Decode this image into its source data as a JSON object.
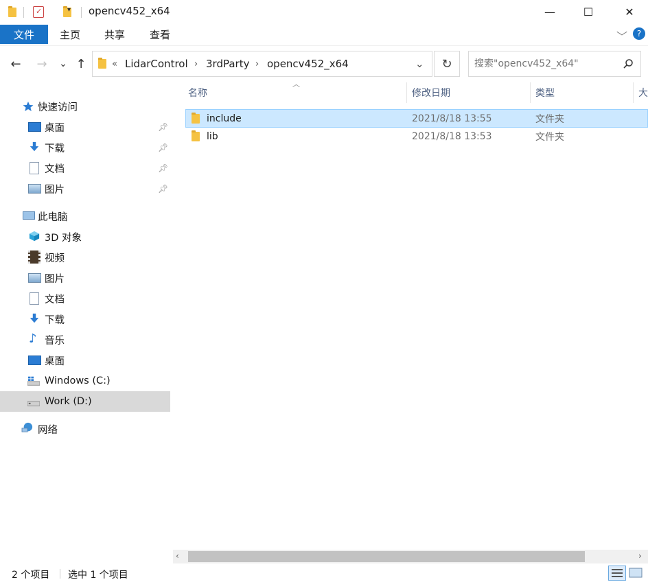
{
  "window": {
    "title": "opencv452_x64",
    "minimize_glyph": "—",
    "maximize_glyph": "☐",
    "close_glyph": "✕"
  },
  "ribbon": {
    "tabs": [
      "文件",
      "主页",
      "共享",
      "查看"
    ],
    "expand_glyph": "﹀",
    "help_glyph": "?"
  },
  "nav": {
    "back_glyph": "←",
    "forward_glyph": "→",
    "recent_glyph": "⌄",
    "up_glyph": "↑",
    "refresh_glyph": "↻",
    "overflow_glyph": "«",
    "dropdown_glyph": "⌄"
  },
  "breadcrumb": [
    "LidarControl",
    "3rdParty",
    "opencv452_x64"
  ],
  "search": {
    "placeholder": "搜索\"opencv452_x64\"",
    "icon": "search-icon"
  },
  "sidebar": {
    "quick_access": "快速访问",
    "quick_items": [
      {
        "label": "桌面",
        "icon": "desktop-icon",
        "pinned": true
      },
      {
        "label": "下载",
        "icon": "download-icon",
        "pinned": true
      },
      {
        "label": "文档",
        "icon": "document-icon",
        "pinned": true
      },
      {
        "label": "图片",
        "icon": "pictures-icon",
        "pinned": true
      }
    ],
    "this_pc": "此电脑",
    "pc_items": [
      {
        "label": "3D 对象",
        "icon": "3d-objects-icon"
      },
      {
        "label": "视频",
        "icon": "video-icon"
      },
      {
        "label": "图片",
        "icon": "pictures-icon"
      },
      {
        "label": "文档",
        "icon": "document-icon"
      },
      {
        "label": "下载",
        "icon": "download-icon"
      },
      {
        "label": "音乐",
        "icon": "music-icon"
      },
      {
        "label": "桌面",
        "icon": "desktop-icon"
      },
      {
        "label": "Windows (C:)",
        "icon": "windows-drive-icon"
      },
      {
        "label": "Work (D:)",
        "icon": "drive-icon",
        "selected": true
      }
    ],
    "network": "网络"
  },
  "columns": [
    "名称",
    "修改日期",
    "类型",
    "大"
  ],
  "files": [
    {
      "name": "include",
      "modified": "2021/8/18 13:55",
      "type": "文件夹",
      "selected": true
    },
    {
      "name": "lib",
      "modified": "2021/8/18 13:53",
      "type": "文件夹",
      "selected": false
    }
  ],
  "status": {
    "count": "2 个项目",
    "selection": "选中 1 个项目"
  },
  "colors": {
    "accent": "#1a73c7",
    "selection": "#cce8ff",
    "nav_selected": "#d9d9d9",
    "header_text": "#4d6082"
  }
}
